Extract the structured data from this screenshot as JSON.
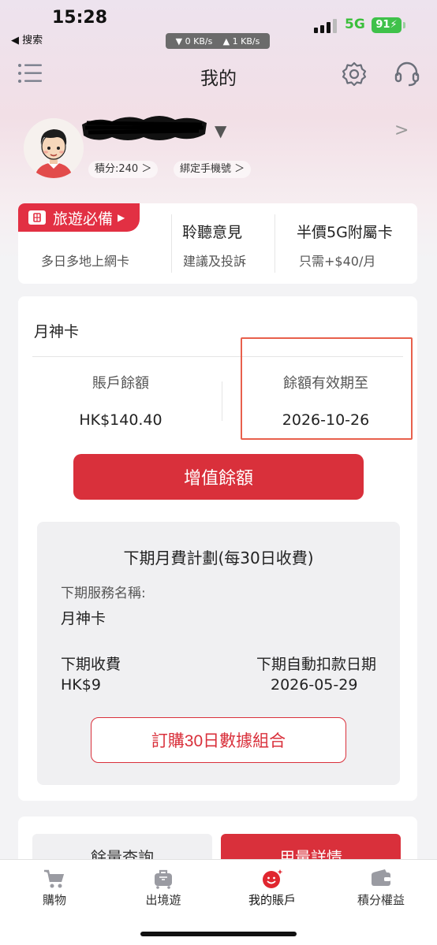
{
  "status_bar": {
    "time": "15:28",
    "back_label": "◀ 搜索",
    "network": "5G",
    "battery": "91",
    "down_speed": "▼ 0 KB/s",
    "up_speed": "▲ 1 KB/s"
  },
  "header": {
    "title": "我的"
  },
  "profile": {
    "points_label": "積分:240 ＞",
    "bind_label": "綁定手機號 ＞",
    "dropdown": "▼",
    "chevron": ">"
  },
  "promo": {
    "tag_label": "旅遊必備",
    "col1_sub": "多日多地上網卡",
    "col2_title": "聆聽意見",
    "col2_sub": "建議及投訴",
    "col3_title": "半價5G附屬卡",
    "col3_sub": "只需+$40/月"
  },
  "balance": {
    "plan_name": "月神卡",
    "balance_label": "賬戶餘額",
    "balance_value": "HK$140.40",
    "expiry_label": "餘額有效期至",
    "expiry_value": "2026-10-26",
    "topup_button": "增值餘額"
  },
  "next_plan": {
    "title": "下期月費計劃(每30日收費)",
    "service_label": "下期服務名稱:",
    "service_value": "月神卡",
    "fee_label": "下期收費",
    "fee_value": "HK$9",
    "debit_label": "下期自動扣款日期",
    "debit_value": "2026-05-29",
    "order_button": "訂購30日數據組合"
  },
  "usage": {
    "tab_left": "餘量查詢",
    "tab_right": "用量詳情"
  },
  "bottom_nav": {
    "items": [
      {
        "label": "購物",
        "icon": "cart-icon"
      },
      {
        "label": "出境遊",
        "icon": "suitcase-icon"
      },
      {
        "label": "我的賬戶",
        "icon": "account-icon"
      },
      {
        "label": "積分權益",
        "icon": "wallet-icon"
      }
    ],
    "active_index": 2
  },
  "colors": {
    "accent": "#d9303b",
    "tag_red": "#e23043",
    "annotation_box": "#e8604c",
    "network_green": "#3bbf3b"
  }
}
